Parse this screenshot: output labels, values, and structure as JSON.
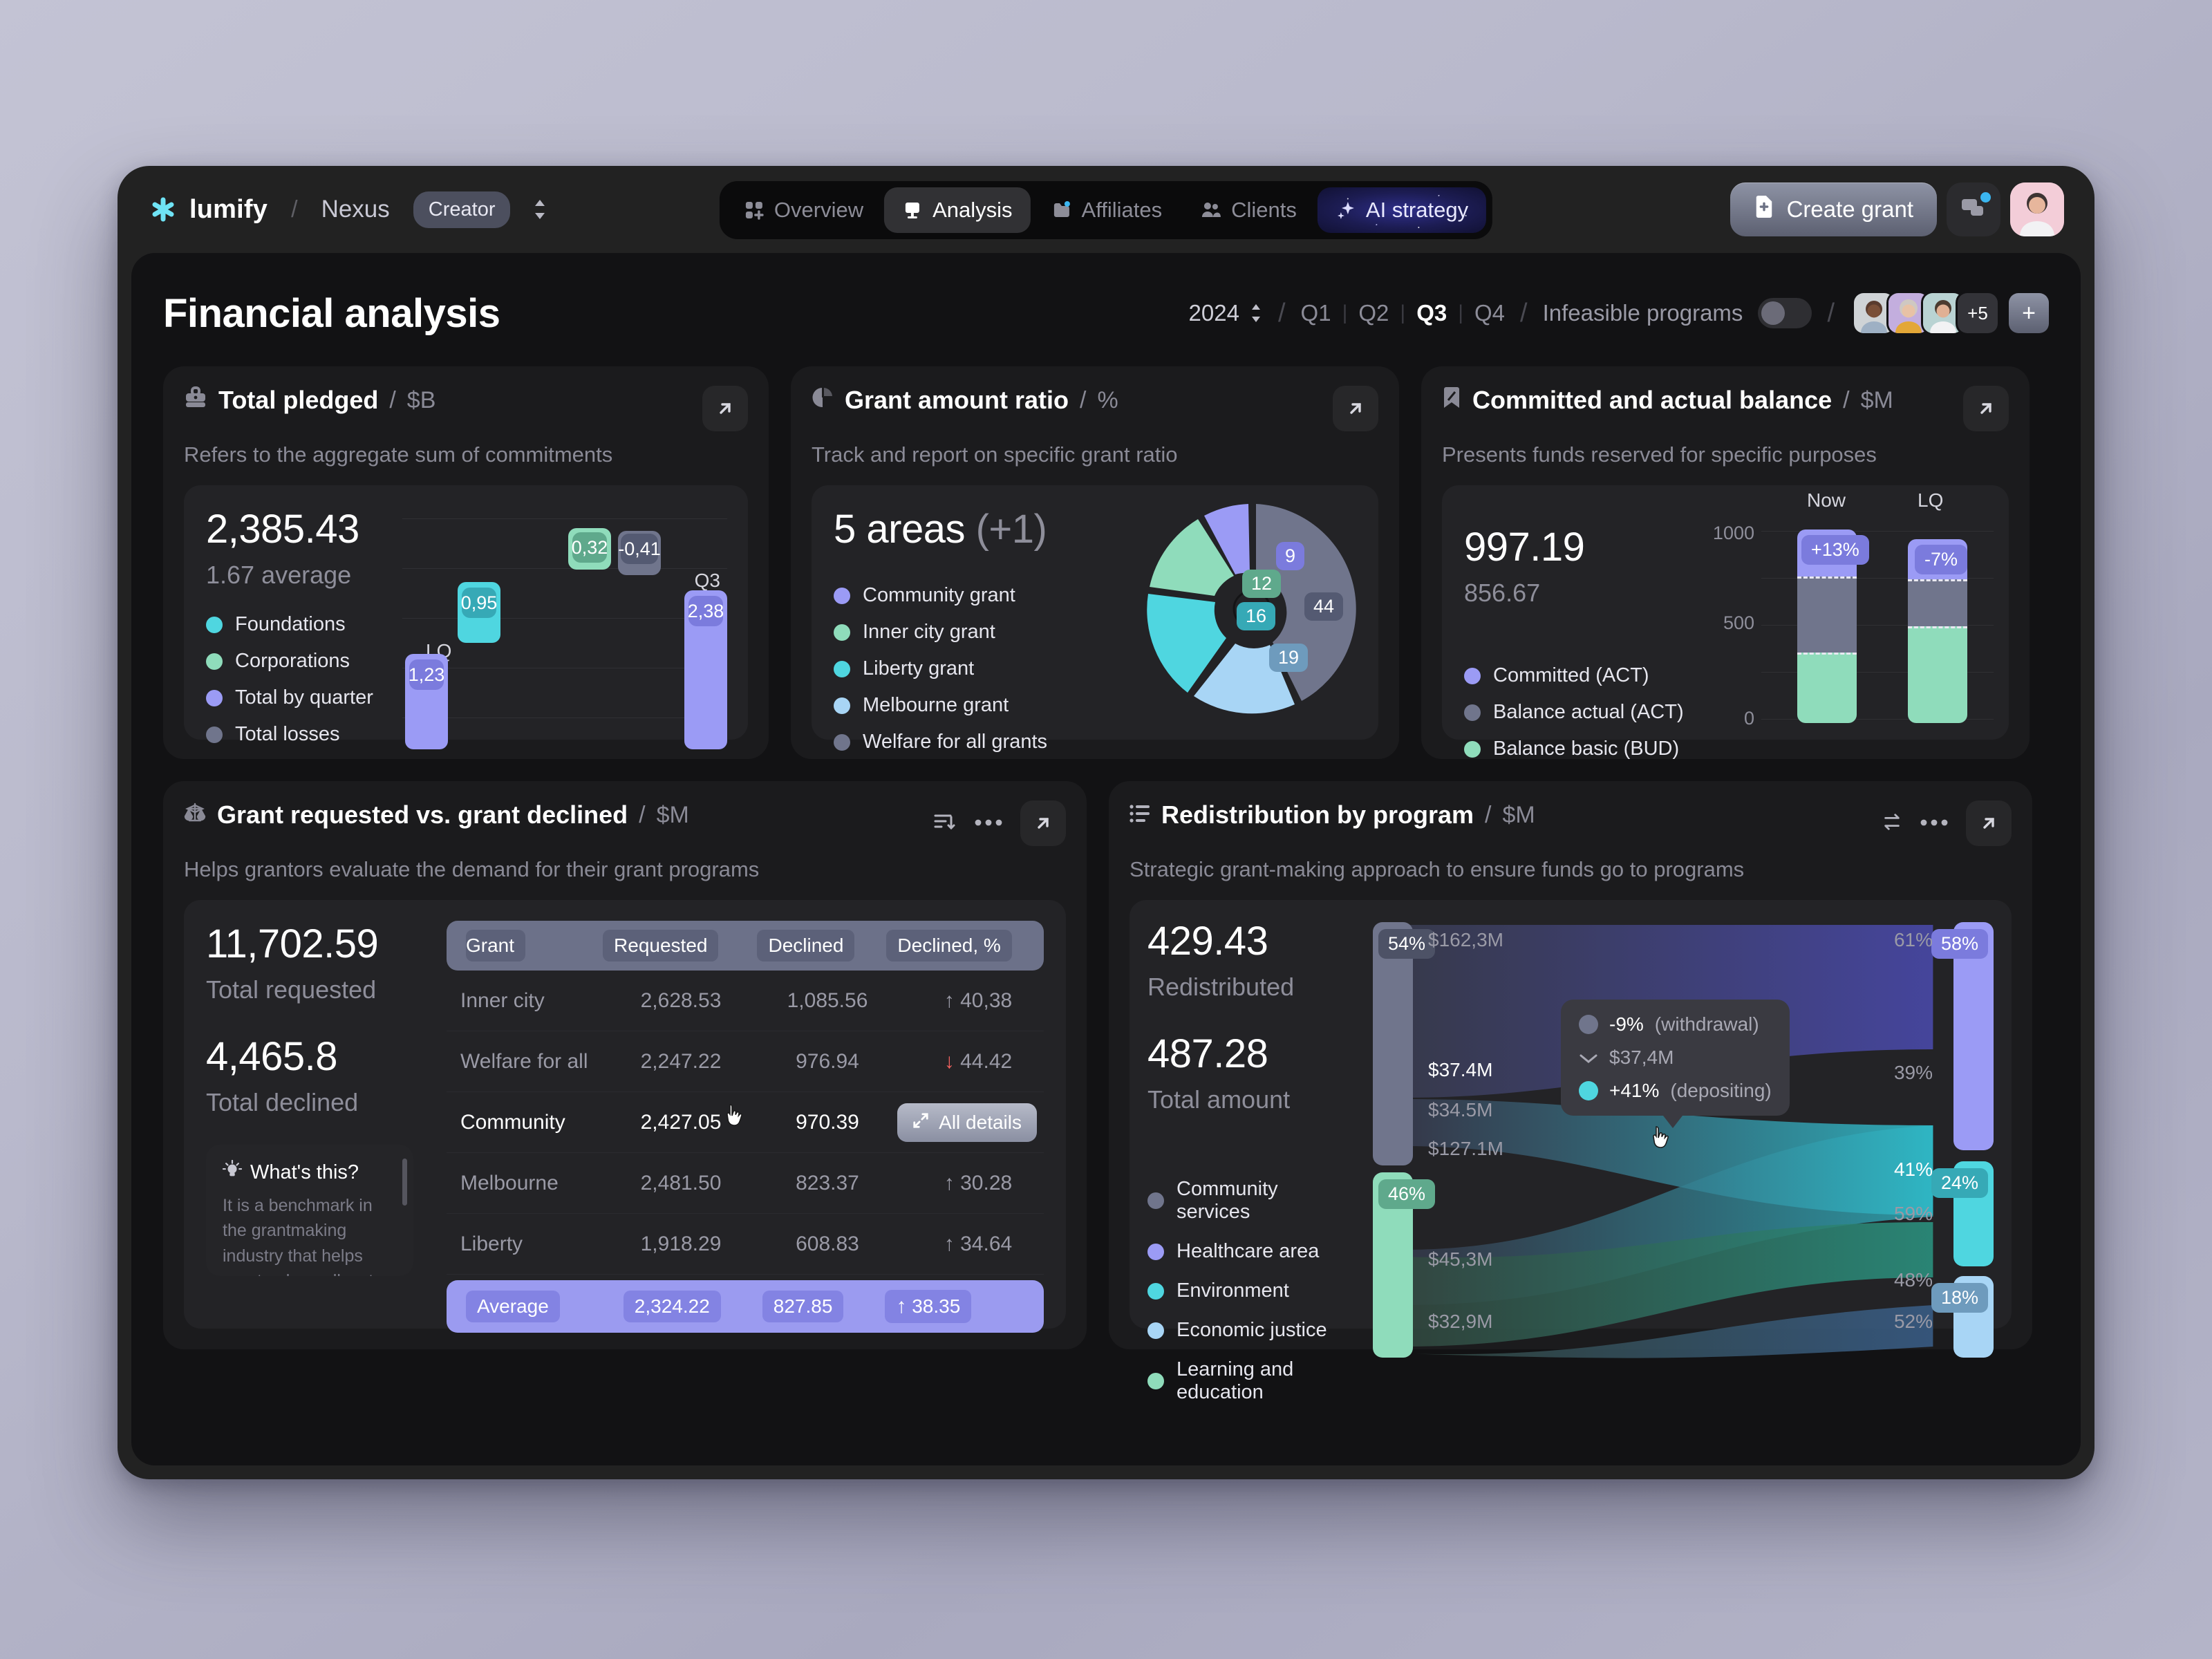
{
  "brand": {
    "name": "lumify",
    "workspace": "Nexus",
    "role": "Creator"
  },
  "nav": [
    {
      "label": "Overview",
      "icon": "grid-icon",
      "active": false
    },
    {
      "label": "Analysis",
      "icon": "podium-icon",
      "active": true
    },
    {
      "label": "Affiliates",
      "icon": "folder-icon",
      "active": false
    },
    {
      "label": "Clients",
      "icon": "people-icon",
      "active": false
    },
    {
      "label": "AI strategy",
      "icon": "sparkle-icon",
      "active": false
    }
  ],
  "top_actions": {
    "create_label": "Create grant",
    "chat_icon": "chat-icon",
    "avatar": "user-avatar"
  },
  "page": {
    "title": "Financial analysis"
  },
  "filters": {
    "year": "2024",
    "quarters": [
      "Q1",
      "Q2",
      "Q3",
      "Q4"
    ],
    "active_quarter": "Q3",
    "toggle_label": "Infeasible programs",
    "toggle_on": false,
    "avatars_more": "+5",
    "add_label": "+"
  },
  "cards": {
    "total_pledged": {
      "title": "Total pledged",
      "unit": "$B",
      "subtitle": "Refers to the aggregate sum of commitments",
      "value": "2,385.43",
      "secondary": "1.67 average",
      "legend": [
        {
          "label": "Foundations",
          "color": "#4fd6e0"
        },
        {
          "label": "Corporations",
          "color": "#8fdcbb"
        },
        {
          "label": "Total by quarter",
          "color": "#9b9bf5"
        },
        {
          "label": "Total losses",
          "color": "#70758c"
        }
      ]
    },
    "grant_ratio": {
      "title": "Grant amount ratio",
      "unit": "%",
      "subtitle": "Track and report on specific grant ratio",
      "value": "5 areas",
      "delta": "(+1)",
      "legend": [
        {
          "label": "Community grant",
          "color": "#9b9bf5"
        },
        {
          "label": "Inner city grant",
          "color": "#8fdcbb"
        },
        {
          "label": "Liberty grant",
          "color": "#4fd6e0"
        },
        {
          "label": "Melbourne grant",
          "color": "#a8d5f5"
        },
        {
          "label": "Welfare for all grants",
          "color": "#70758c"
        }
      ]
    },
    "balance": {
      "title": "Committed and actual balance",
      "unit": "$M",
      "subtitle": "Presents funds reserved for specific purposes",
      "value": "997.19",
      "secondary": "856.67",
      "legend": [
        {
          "label": "Committed (ACT)",
          "color": "#9b9bf5"
        },
        {
          "label": "Balance actual (ACT)",
          "color": "#70758c"
        },
        {
          "label": "Balance basic (BUD)",
          "color": "#8fdcbb"
        }
      ]
    },
    "requested_vs_declined": {
      "title": "Grant requested vs. grant declined",
      "unit": "$M",
      "subtitle": "Helps grantors evaluate the demand for their grant programs",
      "total_requested_value": "11,702.59",
      "total_requested_label": "Total requested",
      "total_declined_value": "4,465.8",
      "total_declined_label": "Total declined",
      "all_details_label": "All details",
      "whats_this_title": "What's this?",
      "whats_this_body": "It is a benchmark in the grantmaking industry that helps grantmakers allocate resources efficiently and guides applicants to make"
    },
    "redistribution": {
      "title": "Redistribution by program",
      "unit": "$M",
      "subtitle": "Strategic grant-making approach to ensure funds go to programs",
      "redistributed_value": "429.43",
      "redistributed_label": "Redistributed",
      "total_value": "487.28",
      "total_label": "Total amount",
      "legend": [
        {
          "label": "Community services",
          "color": "#70758c"
        },
        {
          "label": "Healthcare area",
          "color": "#9b9bf5"
        },
        {
          "label": "Environment",
          "color": "#4fd6e0"
        },
        {
          "label": "Economic justice",
          "color": "#a8d5f5"
        },
        {
          "label": "Learning and education",
          "color": "#8fdcbb"
        }
      ],
      "tooltip": {
        "row1_value": "-9%",
        "row1_note": "(withdrawal)",
        "row2_value": "$37,4M",
        "row3_value": "+41%",
        "row3_note": "(depositing)"
      }
    }
  },
  "chart_data": [
    {
      "type": "bar",
      "title": "Total pledged",
      "ylabel": "$B",
      "categories": [
        "LQ",
        "Q3"
      ],
      "series": [
        {
          "name": "Total by quarter",
          "values": [
            1.23,
            2.38
          ],
          "labels": [
            "1,23",
            "2,38"
          ],
          "color": "#9b9bf5"
        },
        {
          "name": "Foundations",
          "values": [
            0.95,
            null
          ],
          "labels": [
            "0,95",
            null
          ],
          "color": "#4fd6e0"
        },
        {
          "name": "Corporations",
          "values": [
            null,
            0.32
          ],
          "labels": [
            null,
            "0,32"
          ],
          "color": "#8fdcbb"
        },
        {
          "name": "Total losses",
          "values": [
            null,
            -0.41
          ],
          "labels": [
            null,
            "-0,41"
          ],
          "color": "#70758c"
        }
      ],
      "grid": true
    },
    {
      "type": "pie",
      "title": "Grant amount ratio",
      "unit": "%",
      "labels": [
        "Welfare for all grants",
        "Melbourne grant",
        "Liberty grant",
        "Inner city grant",
        "Community grant"
      ],
      "values": [
        44,
        19,
        16,
        12,
        9
      ],
      "value_labels": [
        "44",
        "19",
        "16",
        "12",
        "9"
      ],
      "colors": [
        "#70758c",
        "#a8d5f5",
        "#4fd6e0",
        "#8fdcbb",
        "#9b9bf5"
      ]
    },
    {
      "type": "bar",
      "title": "Committed and actual balance",
      "ylabel": "$M",
      "categories": [
        "Now",
        "LQ"
      ],
      "ylim": [
        0,
        1000
      ],
      "yticks": [
        "0",
        "500",
        "1000"
      ],
      "stacked": true,
      "annotations": [
        "+13%",
        "-7%"
      ],
      "series": [
        {
          "name": "Committed (ACT)",
          "values": [
            330,
            280
          ],
          "color": "#9b9bf5"
        },
        {
          "name": "Balance actual (ACT)",
          "values": [
            420,
            330
          ],
          "color": "#70758c"
        },
        {
          "name": "Balance basic (BUD)",
          "values": [
            250,
            390
          ],
          "color": "#8fdcbb"
        }
      ]
    },
    {
      "type": "table",
      "title": "Grant requested vs. grant declined",
      "columns": [
        "Grant",
        "Requested",
        "Declined",
        "Declined, %"
      ],
      "rows": [
        {
          "grant": "Inner city",
          "requested": "2,628.53",
          "declined": "1,085.56",
          "pct": "40,38",
          "dir": "up",
          "active": false
        },
        {
          "grant": "Welfare for all",
          "requested": "2,247.22",
          "declined": "976.94",
          "pct": "44.42",
          "dir": "down",
          "active": false
        },
        {
          "grant": "Community",
          "requested": "2,427.05",
          "declined": "970.39",
          "pct": "",
          "dir": "",
          "active": true
        },
        {
          "grant": "Melbourne",
          "requested": "2,481.50",
          "declined": "823.37",
          "pct": "30.28",
          "dir": "up",
          "active": false
        },
        {
          "grant": "Liberty",
          "requested": "1,918.29",
          "declined": "608.83",
          "pct": "34.64",
          "dir": "up",
          "active": false
        }
      ],
      "footer": {
        "label": "Average",
        "requested": "2,324.22",
        "declined": "827.85",
        "pct": "38.35",
        "dir": "up"
      }
    },
    {
      "type": "sankey",
      "title": "Redistribution by program",
      "unit": "$M",
      "source_nodes": [
        {
          "label": "54%",
          "color": "#70758c"
        },
        {
          "label": "46%",
          "color": "#8fdcbb"
        }
      ],
      "target_nodes": [
        {
          "label": "58%",
          "color": "#9b9bf5"
        },
        {
          "label": "24%",
          "color": "#4fd6e0"
        },
        {
          "label": "18%",
          "color": "#a8d5f5"
        }
      ],
      "flow_values": [
        "$162,3M",
        "$37.4M",
        "$34.5M",
        "$127.1M",
        "$45,3M",
        "$32,9M"
      ],
      "flow_percents": [
        "61%",
        "39%",
        "41%",
        "59%",
        "48%",
        "52%"
      ]
    }
  ]
}
